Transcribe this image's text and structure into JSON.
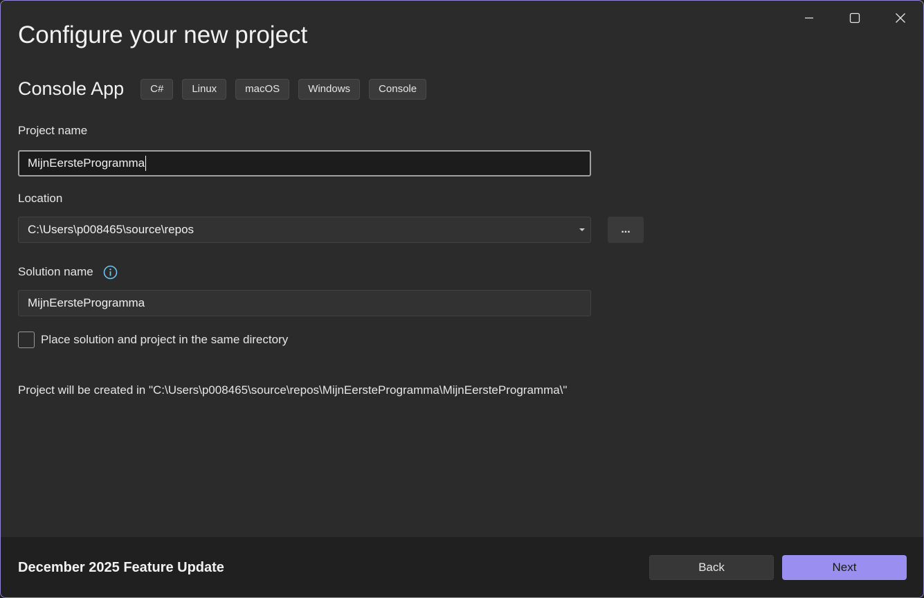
{
  "window": {
    "controls": {
      "minimize_icon": "minimize-icon",
      "maximize_icon": "maximize-icon",
      "close_icon": "close-icon"
    }
  },
  "header": {
    "title": "Configure your new project"
  },
  "template": {
    "name": "Console App",
    "tags": [
      "C#",
      "Linux",
      "macOS",
      "Windows",
      "Console"
    ]
  },
  "form": {
    "project_name_label": "Project name",
    "project_name_value": "MijnEersteProgramma",
    "location_label": "Location",
    "location_value": "C:\\Users\\p008465\\source\\repos",
    "browse_label": "...",
    "solution_name_label": "Solution name",
    "solution_name_value": "MijnEersteProgramma",
    "same_directory_label": "Place solution and project in the same directory",
    "same_directory_checked": false,
    "created_in_message": "Project will be created in \"C:\\Users\\p008465\\source\\repos\\MijnEersteProgramma\\MijnEersteProgramma\\\""
  },
  "footer": {
    "feature_update": "December 2025 Feature Update",
    "back_label": "Back",
    "next_label": "Next"
  },
  "colors": {
    "accent": "#9a8ef0",
    "window_border": "#8f87d6",
    "background": "#2b2b2b",
    "info_icon": "#6cc4f0"
  }
}
